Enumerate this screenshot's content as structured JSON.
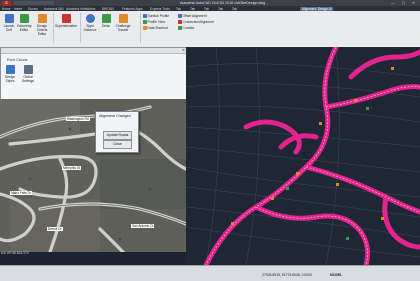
{
  "app": {
    "title": "Autodesk AutoCAD Civil 3D 2016    civilSiteDesign.dwg",
    "menu_button": "C",
    "window_controls": "— ▢ ✕"
  },
  "tabs": [
    {
      "label": "Home"
    },
    {
      "label": "Insert"
    },
    {
      "label": "Survey"
    },
    {
      "label": "Autodesk 360"
    },
    {
      "label": "Autodesk InfraWorks"
    },
    {
      "label": "BIM 360"
    },
    {
      "label": "Featured Apps"
    },
    {
      "label": "Express Tools"
    },
    {
      "label": "Tab"
    },
    {
      "label": "Tab"
    },
    {
      "label": "Tab"
    },
    {
      "label": "Tab"
    },
    {
      "label": "Tab"
    },
    {
      "label": "Alignment: Design Al"
    }
  ],
  "ribbon": {
    "buttons": [
      {
        "label": "Launch Civil"
      },
      {
        "label": "Geometry Editor"
      },
      {
        "label": "Design Criteria Editor"
      },
      {
        "label": "Superelevation"
      },
      {
        "label": "Sight Distance"
      },
      {
        "label": "Drive"
      },
      {
        "label": "Challenge Tracker"
      }
    ],
    "small_buttons": [
      {
        "label": "Surface Profile"
      },
      {
        "label": "Profile View"
      },
      {
        "label": "Data Shortcut"
      },
      {
        "label": "Offset Alignment"
      },
      {
        "label": "Connected Alignment"
      },
      {
        "label": "Corridor"
      }
    ],
    "colors": {
      "icon_blue": "#3f74c4",
      "icon_green": "#3c9a45",
      "icon_orange": "#e08a2b",
      "icon_red": "#c4362e"
    }
  },
  "pointcloud_panel": {
    "title": "Point Clouds",
    "buttons": [
      {
        "label": "Design Styles"
      },
      {
        "label": "Global Settings"
      }
    ]
  },
  "dialog": {
    "title": "Alignment Changed",
    "update_label": "Update Roads",
    "close_label": "Close"
  },
  "map_labels": [
    {
      "text": "Washington Rd"
    },
    {
      "text": "Memphis St"
    },
    {
      "text": "Idaho Falls Dr"
    },
    {
      "text": "Detroit Dr"
    },
    {
      "text": "San Antonio Ct"
    }
  ],
  "status": {
    "left_coord": "6.8 197.60.831.170",
    "coords": "27925.8915, 91775.8048, 0.0000",
    "model": "MODEL"
  },
  "cad_colors": {
    "road": "#e5238f",
    "edge": "#ff4fb1",
    "lines": "#3d4a5b",
    "center": "#dcdcdc",
    "pad": "#e0861f"
  }
}
